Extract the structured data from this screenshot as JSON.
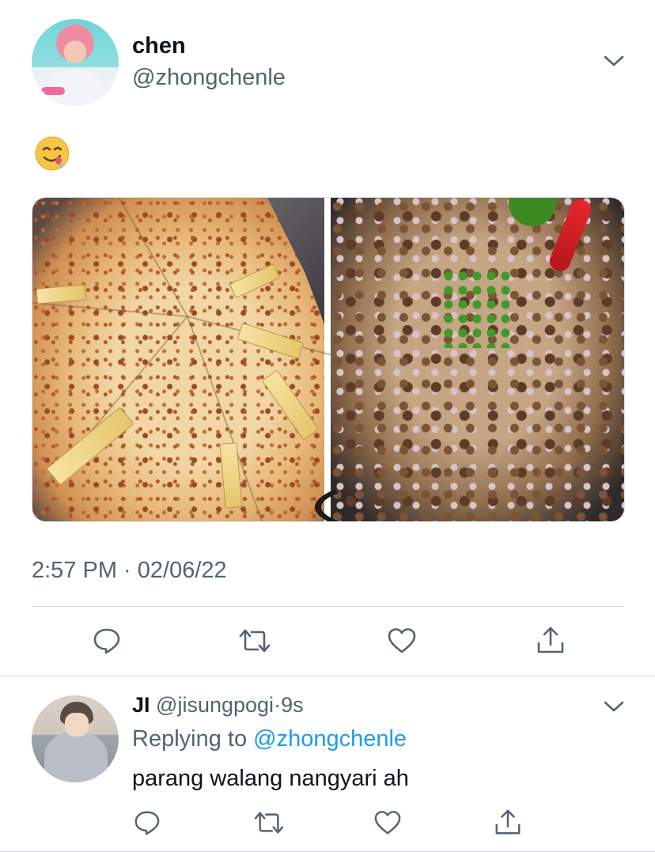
{
  "tweet": {
    "author_name": "chen",
    "author_handle": "@zhongchenle",
    "text_emoji": "drooling-face",
    "timestamp": "2:57 PM · 02/06/22",
    "images": [
      "pizza-photo",
      "sisig-photo"
    ]
  },
  "actions": {
    "reply": "reply-icon",
    "retweet": "retweet-icon",
    "like": "heart-icon",
    "share": "share-icon"
  },
  "reply": {
    "author_name": "JI",
    "author_handle": "@jisungpogi",
    "separator": "·",
    "time": "9s",
    "replying_prefix": "Replying to ",
    "replying_to": "@zhongchenle",
    "text": "parang walang nangyari ah"
  },
  "colors": {
    "text_primary": "#0f1419",
    "text_secondary": "#536471",
    "accent": "#1d9bf0",
    "divider": "#cfd9de"
  }
}
